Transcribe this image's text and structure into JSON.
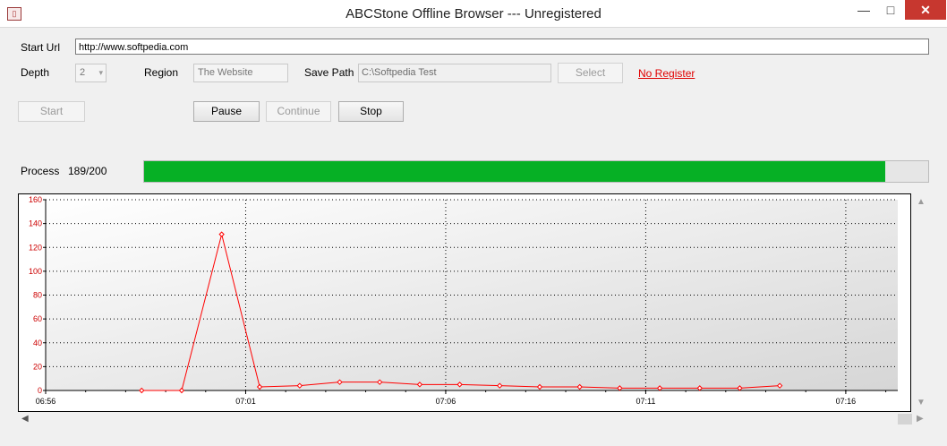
{
  "window": {
    "app_icon_glyph": "▯",
    "title": "ABCStone Offline Browser  ---   Unregistered",
    "minimize": "—",
    "maximize": "□",
    "close": "✕"
  },
  "form": {
    "start_url_label": "Start Url",
    "start_url_value": "http://www.softpedia.com",
    "depth_label": "Depth",
    "depth_value": "2",
    "region_label": "Region",
    "region_value": "The Website",
    "save_path_label": "Save Path",
    "save_path_value": "C:\\Softpedia Test",
    "select_button": "Select",
    "no_register_link": "No Register"
  },
  "buttons": {
    "start": "Start",
    "pause": "Pause",
    "continue": "Continue",
    "stop": "Stop"
  },
  "process": {
    "label": "Process",
    "count_text": "189/200",
    "done": 189,
    "total": 200
  },
  "colors": {
    "progress_fill": "#06b025",
    "series": "#ff0000",
    "axis_label": "#cc0000"
  },
  "chart_data": {
    "type": "line",
    "title": "",
    "xlabel": "",
    "ylabel": "",
    "ylim": [
      0,
      160
    ],
    "xlim_minutes": [
      0,
      21.3
    ],
    "y_ticks": [
      "0",
      "20",
      "40",
      "60",
      "80",
      "100",
      "120",
      "140",
      "160"
    ],
    "x_ticks": [
      {
        "label": "06:56",
        "min": 0
      },
      {
        "label": "07:01",
        "min": 5
      },
      {
        "label": "07:06",
        "min": 10
      },
      {
        "label": "07:11",
        "min": 15
      },
      {
        "label": "07:16",
        "min": 20
      }
    ],
    "grid": true,
    "series": [
      {
        "points": [
          {
            "x": 2.4,
            "y": 0
          },
          {
            "x": 3.4,
            "y": 0
          },
          {
            "x": 4.4,
            "y": 131
          },
          {
            "x": 5.35,
            "y": 3
          },
          {
            "x": 6.35,
            "y": 4
          },
          {
            "x": 7.35,
            "y": 7
          },
          {
            "x": 8.35,
            "y": 7
          },
          {
            "x": 9.35,
            "y": 5
          },
          {
            "x": 10.35,
            "y": 5
          },
          {
            "x": 11.35,
            "y": 4
          },
          {
            "x": 12.35,
            "y": 3
          },
          {
            "x": 13.35,
            "y": 3
          },
          {
            "x": 14.35,
            "y": 2
          },
          {
            "x": 15.35,
            "y": 2
          },
          {
            "x": 16.35,
            "y": 2
          },
          {
            "x": 17.35,
            "y": 2
          },
          {
            "x": 18.35,
            "y": 4
          }
        ]
      }
    ]
  },
  "scroll": {
    "up": "▲",
    "down": "▼",
    "left": "◀",
    "right": "▶"
  }
}
